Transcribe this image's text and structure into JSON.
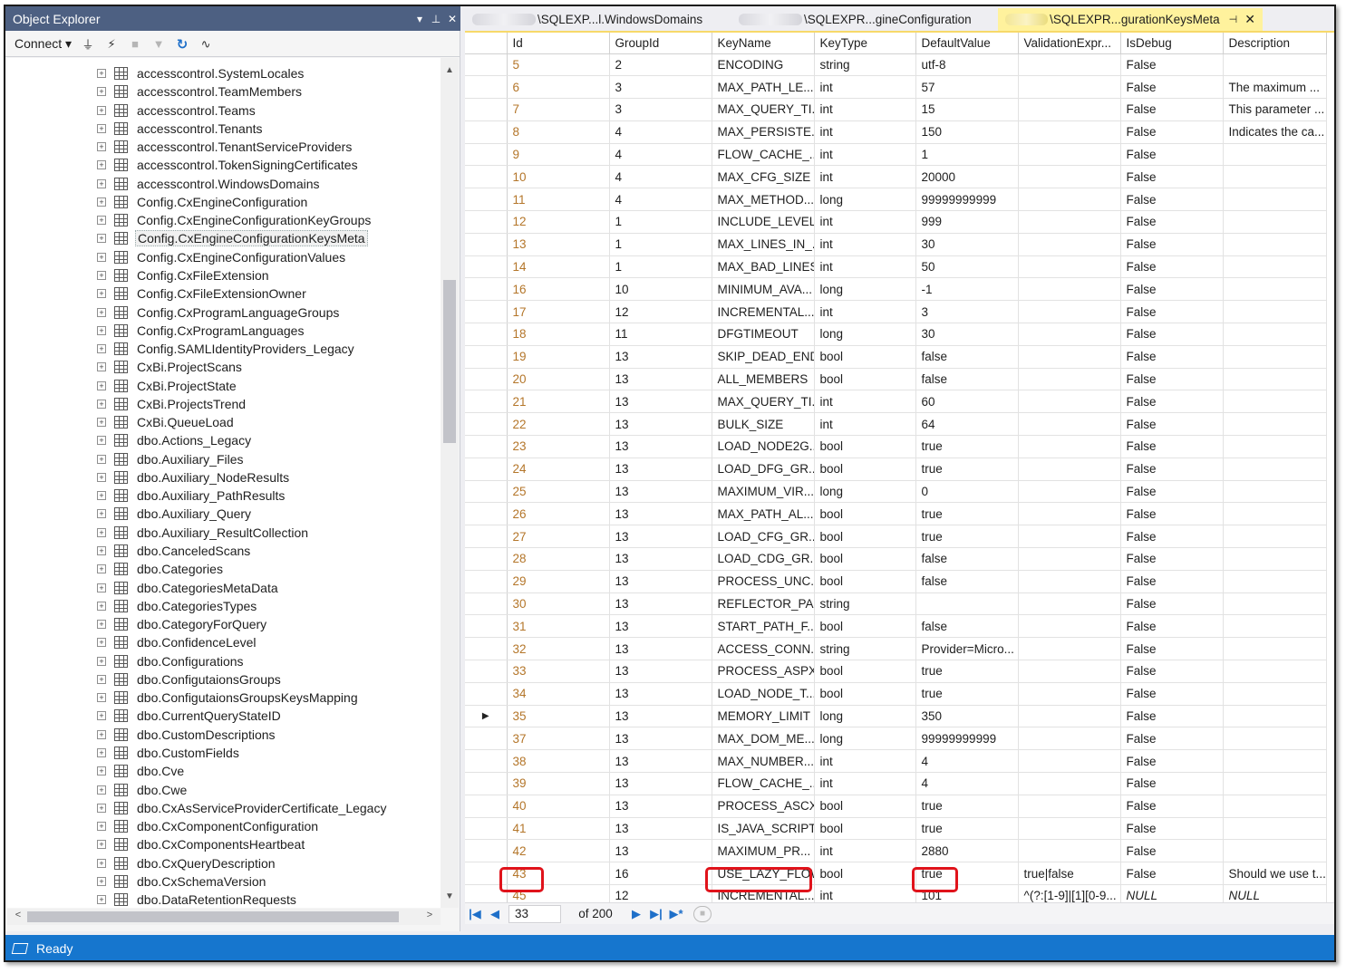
{
  "object_explorer": {
    "title": "Object Explorer",
    "connect_label": "Connect ▾",
    "tree_items": [
      "accesscontrol.SystemLocales",
      "accesscontrol.TeamMembers",
      "accesscontrol.Teams",
      "accesscontrol.Tenants",
      "accesscontrol.TenantServiceProviders",
      "accesscontrol.TokenSigningCertificates",
      "accesscontrol.WindowsDomains",
      "Config.CxEngineConfiguration",
      "Config.CxEngineConfigurationKeyGroups",
      "Config.CxEngineConfigurationKeysMeta",
      "Config.CxEngineConfigurationValues",
      "Config.CxFileExtension",
      "Config.CxFileExtensionOwner",
      "Config.CxProgramLanguageGroups",
      "Config.CxProgramLanguages",
      "Config.SAMLIdentityProviders_Legacy",
      "CxBi.ProjectScans",
      "CxBi.ProjectState",
      "CxBi.ProjectsTrend",
      "CxBi.QueueLoad",
      "dbo.Actions_Legacy",
      "dbo.Auxiliary_Files",
      "dbo.Auxiliary_NodeResults",
      "dbo.Auxiliary_PathResults",
      "dbo.Auxiliary_Query",
      "dbo.Auxiliary_ResultCollection",
      "dbo.CanceledScans",
      "dbo.Categories",
      "dbo.CategoriesMetaData",
      "dbo.CategoriesTypes",
      "dbo.CategoryForQuery",
      "dbo.ConfidenceLevel",
      "dbo.Configurations",
      "dbo.ConfigutaionsGroups",
      "dbo.ConfigutaionsGroupsKeysMapping",
      "dbo.CurrentQueryStateID",
      "dbo.CustomDescriptions",
      "dbo.CustomFields",
      "dbo.Cve",
      "dbo.Cwe",
      "dbo.CxAsServiceProviderCertificate_Legacy",
      "dbo.CxComponentConfiguration",
      "dbo.CxComponentsHeartbeat",
      "dbo.CxQueryDescription",
      "dbo.CxSchemaVersion",
      "dbo.DataRetentionRequests"
    ],
    "selected_item": "Config.CxEngineConfigurationKeysMeta"
  },
  "tabs": [
    {
      "label": "\\SQLEXP...l.WindowsDomains",
      "active": false
    },
    {
      "label": "\\SQLEXPR...gineConfiguration",
      "active": false
    },
    {
      "label": "\\SQLEXPR...gurationKeysMeta",
      "active": true
    }
  ],
  "grid": {
    "columns": [
      "Id",
      "GroupId",
      "KeyName",
      "KeyType",
      "DefaultValue",
      "ValidationExpr...",
      "IsDebug",
      "Description"
    ],
    "rows": [
      [
        "5",
        "2",
        "ENCODING",
        "string",
        "utf-8",
        "",
        "False",
        ""
      ],
      [
        "6",
        "3",
        "MAX_PATH_LE...",
        "int",
        "57",
        "",
        "False",
        "The maximum ..."
      ],
      [
        "7",
        "3",
        "MAX_QUERY_TI...",
        "int",
        "15",
        "",
        "False",
        "This parameter ..."
      ],
      [
        "8",
        "4",
        "MAX_PERSISTE...",
        "int",
        "150",
        "",
        "False",
        "Indicates the ca..."
      ],
      [
        "9",
        "4",
        "FLOW_CACHE_...",
        "int",
        "1",
        "",
        "False",
        ""
      ],
      [
        "10",
        "4",
        "MAX_CFG_SIZE",
        "int",
        "20000",
        "",
        "False",
        ""
      ],
      [
        "11",
        "4",
        "MAX_METHOD...",
        "long",
        "99999999999",
        "",
        "False",
        ""
      ],
      [
        "12",
        "1",
        "INCLUDE_LEVEL",
        "int",
        "999",
        "",
        "False",
        ""
      ],
      [
        "13",
        "1",
        "MAX_LINES_IN_...",
        "int",
        "30",
        "",
        "False",
        ""
      ],
      [
        "14",
        "1",
        "MAX_BAD_LINES",
        "int",
        "50",
        "",
        "False",
        ""
      ],
      [
        "16",
        "10",
        "MINIMUM_AVA...",
        "long",
        "-1",
        "",
        "False",
        ""
      ],
      [
        "17",
        "12",
        "INCREMENTAL...",
        "int",
        "3",
        "",
        "False",
        ""
      ],
      [
        "18",
        "11",
        "DFGTIMEOUT",
        "long",
        "30",
        "",
        "False",
        ""
      ],
      [
        "19",
        "13",
        "SKIP_DEAD_END",
        "bool",
        "false",
        "",
        "False",
        ""
      ],
      [
        "20",
        "13",
        "ALL_MEMBERS",
        "bool",
        "false",
        "",
        "False",
        ""
      ],
      [
        "21",
        "13",
        "MAX_QUERY_TI...",
        "int",
        "60",
        "",
        "False",
        ""
      ],
      [
        "22",
        "13",
        "BULK_SIZE",
        "int",
        "64",
        "",
        "False",
        ""
      ],
      [
        "23",
        "13",
        "LOAD_NODE2G...",
        "bool",
        "true",
        "",
        "False",
        ""
      ],
      [
        "24",
        "13",
        "LOAD_DFG_GR...",
        "bool",
        "true",
        "",
        "False",
        ""
      ],
      [
        "25",
        "13",
        "MAXIMUM_VIR...",
        "long",
        "0",
        "",
        "False",
        ""
      ],
      [
        "26",
        "13",
        "MAX_PATH_AL...",
        "bool",
        "true",
        "",
        "False",
        ""
      ],
      [
        "27",
        "13",
        "LOAD_CFG_GR...",
        "bool",
        "true",
        "",
        "False",
        ""
      ],
      [
        "28",
        "13",
        "LOAD_CDG_GR...",
        "bool",
        "false",
        "",
        "False",
        ""
      ],
      [
        "29",
        "13",
        "PROCESS_UNC...",
        "bool",
        "false",
        "",
        "False",
        ""
      ],
      [
        "30",
        "13",
        "REFLECTOR_PA...",
        "string",
        "",
        "",
        "False",
        ""
      ],
      [
        "31",
        "13",
        "START_PATH_F...",
        "bool",
        "false",
        "",
        "False",
        ""
      ],
      [
        "32",
        "13",
        "ACCESS_CONN...",
        "string",
        "Provider=Micro...",
        "",
        "False",
        ""
      ],
      [
        "33",
        "13",
        "PROCESS_ASPX",
        "bool",
        "true",
        "",
        "False",
        ""
      ],
      [
        "34",
        "13",
        "LOAD_NODE_T...",
        "bool",
        "true",
        "",
        "False",
        ""
      ],
      [
        "35",
        "13",
        "MEMORY_LIMIT",
        "long",
        "350",
        "",
        "False",
        ""
      ],
      [
        "37",
        "13",
        "MAX_DOM_ME...",
        "long",
        "99999999999",
        "",
        "False",
        ""
      ],
      [
        "38",
        "13",
        "MAX_NUMBER...",
        "int",
        "4",
        "",
        "False",
        ""
      ],
      [
        "39",
        "13",
        "FLOW_CACHE_...",
        "int",
        "4",
        "",
        "False",
        ""
      ],
      [
        "40",
        "13",
        "PROCESS_ASCX",
        "bool",
        "true",
        "",
        "False",
        ""
      ],
      [
        "41",
        "13",
        "IS_JAVA_SCRIPT...",
        "bool",
        "true",
        "",
        "False",
        ""
      ],
      [
        "42",
        "13",
        "MAXIMUM_PR...",
        "int",
        "2880",
        "",
        "False",
        ""
      ],
      [
        "43",
        "16",
        "USE_LAZY_FLOW",
        "bool",
        "true",
        "true|false",
        "False",
        "Should we use t..."
      ],
      [
        "45",
        "12",
        "INCREMENTAL...",
        "int",
        "101",
        "^(?:[1-9]|[1][0-9...",
        "NULL",
        "NULL"
      ]
    ],
    "current_row_index": 29
  },
  "navigator": {
    "current_position": "33",
    "of_total": "of 200"
  },
  "status_bar": {
    "text": "Ready",
    "color": "#1676ce"
  }
}
